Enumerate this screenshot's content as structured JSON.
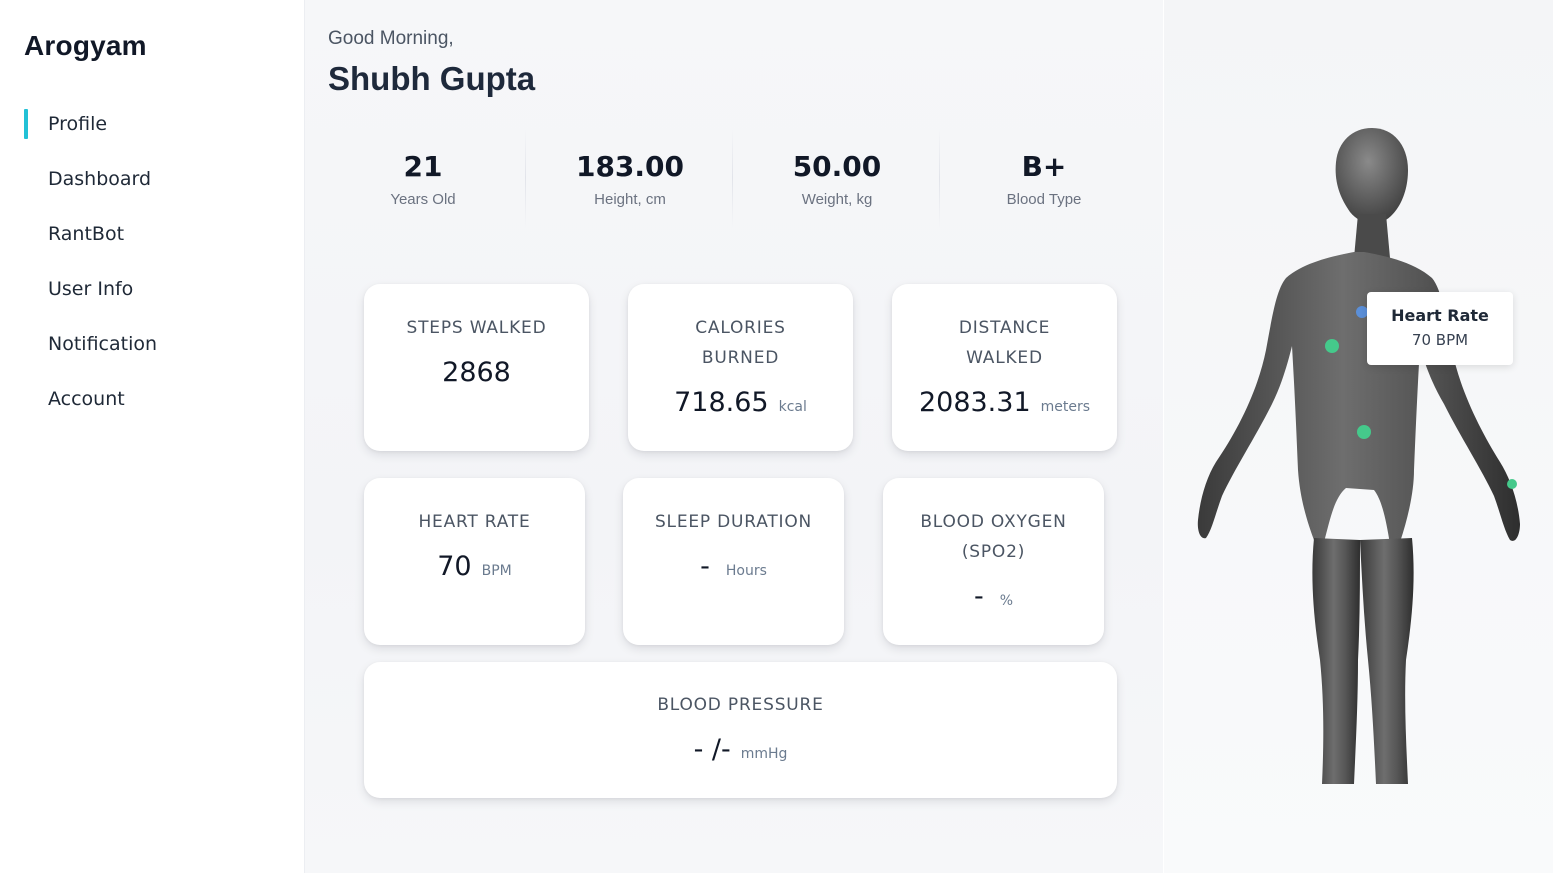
{
  "app": {
    "brand": "Arogyam"
  },
  "sidebar": {
    "items": [
      {
        "label": "Profile",
        "active": true
      },
      {
        "label": "Dashboard"
      },
      {
        "label": "RantBot"
      },
      {
        "label": "User Info"
      },
      {
        "label": "Notification"
      },
      {
        "label": "Account"
      }
    ]
  },
  "header": {
    "greeting": "Good Morning,",
    "name": "Shubh Gupta"
  },
  "stats": [
    {
      "value": "21",
      "label": "Years Old"
    },
    {
      "value": "183.00",
      "label": "Height, cm"
    },
    {
      "value": "50.00",
      "label": "Weight, kg"
    },
    {
      "value": "B+",
      "label": "Blood Type"
    }
  ],
  "metrics": {
    "steps": {
      "title": "STEPS WALKED",
      "value": "2868"
    },
    "calories": {
      "title_line1": "CALORIES",
      "title_line2": "BURNED",
      "value": "718.65",
      "unit": "kcal"
    },
    "distance": {
      "title_line1": "DISTANCE",
      "title_line2": "WALKED",
      "value": "2083.31",
      "unit": "meters"
    },
    "heart_rate": {
      "title": "HEART RATE",
      "value": "70",
      "unit": "BPM"
    },
    "sleep": {
      "title": "SLEEP DURATION",
      "value": "-",
      "unit": "Hours"
    },
    "oxygen": {
      "title_line1": "BLOOD OXYGEN",
      "title_line2": "(SPO2)",
      "value": "-",
      "unit": "%"
    },
    "pressure": {
      "title": "BLOOD PRESSURE",
      "value": "- /-",
      "unit": "mmHg"
    }
  },
  "body_model": {
    "tooltip": {
      "title": "Heart Rate",
      "value": "70 BPM"
    },
    "marker_colors": {
      "primary": "#45c98b",
      "selected": "#5b8fd8"
    }
  },
  "colors": {
    "accent": "#22c1d6"
  }
}
